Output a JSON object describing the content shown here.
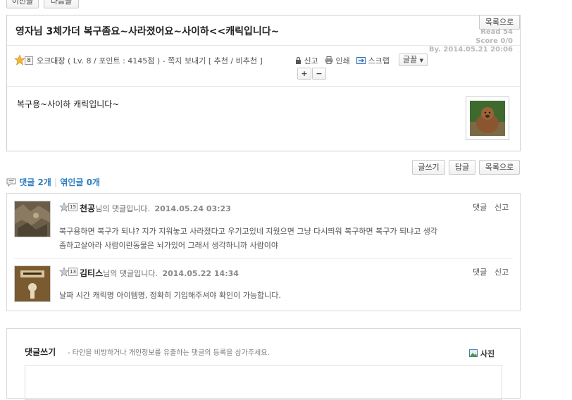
{
  "nav": {
    "prev_label": "이전글",
    "next_label": "다음글"
  },
  "post": {
    "list_label": "목록으로",
    "title": "영자님 3체가더 복구좀요~사라졌어요~사이하<<캐릭입니다~",
    "read": "Read 54",
    "score": "Score 0/0",
    "date": "By. 2014.05.21 20:06",
    "author": {
      "level_badge": "8",
      "name": "오크대장",
      "info": "( Lv. 8 / 포인트 : 4145점 )",
      "dash": "-",
      "message_label": "쪽지 보내기",
      "rec_open": "[",
      "recommend_label": "추천",
      "slash": "/",
      "unrecommend_label": "비추천",
      "rec_close": "]"
    },
    "actions": {
      "report_label": "신고",
      "print_label": "인쇄",
      "scrap_label": "스크랩",
      "font_label": "글꼴",
      "plus_label": "+",
      "minus_label": "−"
    },
    "body": "복구용~사이하 캐릭입니다~"
  },
  "bottom_buttons": {
    "write_label": "글쓰기",
    "reply_label": "답글",
    "list_label": "목록으로"
  },
  "comment_counts": {
    "comments": "댓글 2개",
    "trackbacks": "엮인글 0개"
  },
  "comments": [
    {
      "level_badge": "15",
      "name": "천공",
      "suffix": "님의 댓글입니다.",
      "date": "2014.05.24 03:23",
      "reply_label": "댓글",
      "report_label": "신고",
      "text_line1": "복구용하면 복구가 되냐? 지가 지워놓고 사라졌다고 우기고있네 지웠으면 그냥 다시띄워 복구하면 복구가 되냐고 생각",
      "text_line2": "좀하고살아라 사람이란동물은 뇌가있어 그래서 생각하니까 사람이야"
    },
    {
      "level_badge": "13",
      "name": "김티스",
      "suffix": "님의 댓글입니다.",
      "date": "2014.05.22 14:34",
      "reply_label": "댓글",
      "report_label": "신고",
      "text_line1": "날짜 시간 캐릭명 아이템명, 정확히 기입해주셔야 확인이 가능합니다."
    }
  ],
  "write_comment": {
    "title": "댓글쓰기",
    "notice": "- 타인을 비방하거나 개인정보를 유출하는 댓글의 등록을 삼가주세요.",
    "photo_label": "사진"
  },
  "colors": {
    "accent": "#2f7fc1",
    "meta_gray": "#b8b8b8",
    "border": "#d9d9d9"
  }
}
